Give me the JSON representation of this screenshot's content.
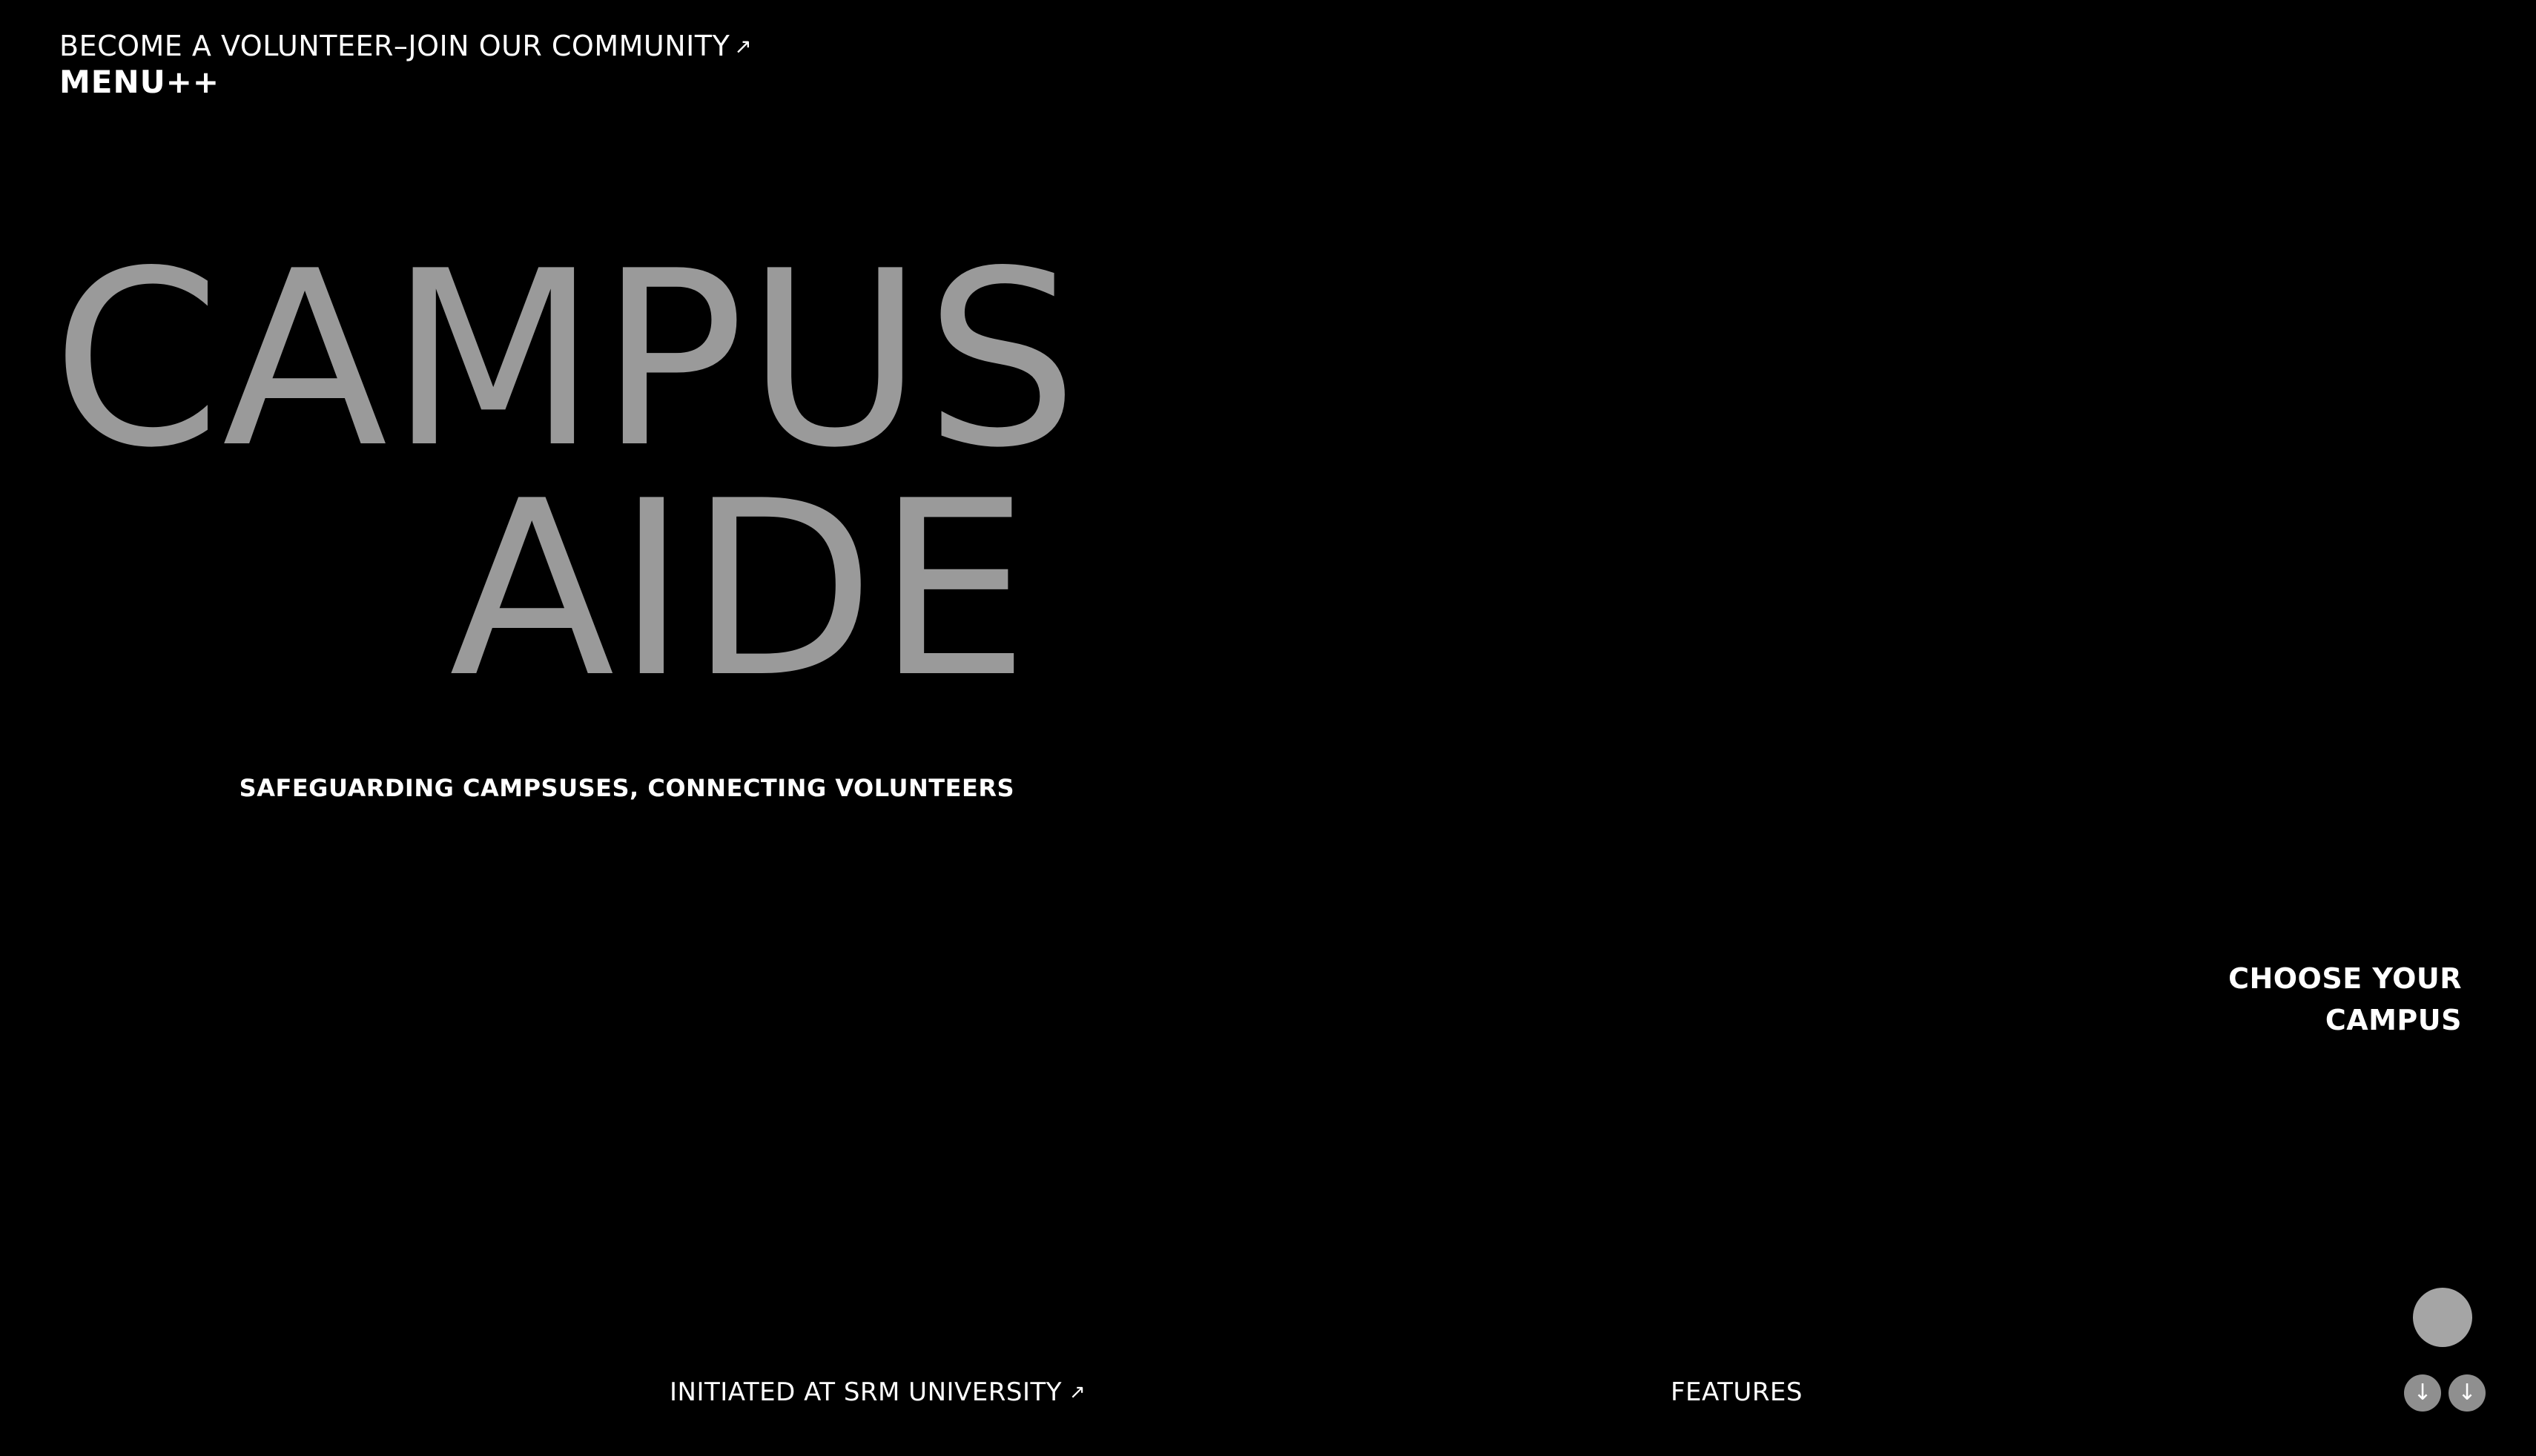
{
  "header": {
    "volunteer_link": "BECOME A VOLUNTEER–JOIN OUR COMMUNITY",
    "volunteer_arrow": "↗",
    "menu_label": "MENU++"
  },
  "hero": {
    "title_line1": "CAMPUS",
    "title_line2": "AIDE",
    "tagline": "SAFEGUARDING CAMPSUSES, CONNECTING VOLUNTEERS"
  },
  "campus_selector": {
    "line1": "CHOOSE YOUR",
    "line2": "CAMPUS"
  },
  "footer": {
    "srm_link": "INITIATED AT SRM UNIVERSITY",
    "srm_arrow": "↗",
    "features_label": "FEATURES",
    "scroll_icon_1": "↓",
    "scroll_icon_2": "↓"
  },
  "colors": {
    "background": "#000000",
    "hero_title": "#9a9a9a",
    "text": "#ffffff",
    "circle_button": "#a5a5a5",
    "scroll_button": "#8f8f8f"
  },
  "icons": {
    "volunteer_arrow": "arrow-up-right-icon",
    "srm_arrow": "arrow-up-right-icon",
    "scroll_buttons": "arrow-down-icon"
  }
}
